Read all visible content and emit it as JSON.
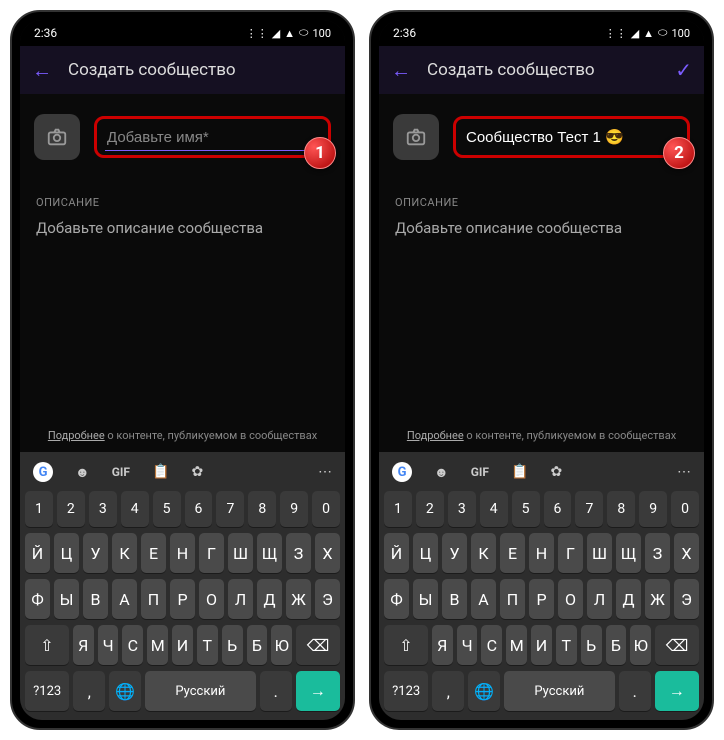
{
  "status": {
    "time": "2:36",
    "battery": "100"
  },
  "header": {
    "title": "Создать сообщество"
  },
  "screens": [
    {
      "namePlaceholder": "Добавьте имя*",
      "nameValue": "",
      "showCheck": false,
      "badge": "1"
    },
    {
      "namePlaceholder": "Добавьте имя*",
      "nameValue": "Сообщество Тест 1 😎",
      "showCheck": true,
      "badge": "2"
    }
  ],
  "description": {
    "label": "ОПИСАНИЕ",
    "placeholder": "Добавьте описание сообщества"
  },
  "footer": {
    "linkWord": "Подробнее",
    "rest": " о контенте, публикуемом в сообществах"
  },
  "keyboard": {
    "toolbar": {
      "gif": "GIF"
    },
    "numRow": [
      "1",
      "2",
      "3",
      "4",
      "5",
      "6",
      "7",
      "8",
      "9",
      "0"
    ],
    "row1": [
      "Й",
      "Ц",
      "У",
      "К",
      "Е",
      "Н",
      "Г",
      "Ш",
      "Щ",
      "З",
      "Х"
    ],
    "row2": [
      "Ф",
      "Ы",
      "В",
      "А",
      "П",
      "Р",
      "О",
      "Л",
      "Д",
      "Ж",
      "Э"
    ],
    "row3": [
      "Я",
      "Ч",
      "С",
      "М",
      "И",
      "Т",
      "Ь",
      "Б",
      "Ю"
    ],
    "bottom": {
      "sym": "?123",
      "lang": "Русский"
    }
  }
}
